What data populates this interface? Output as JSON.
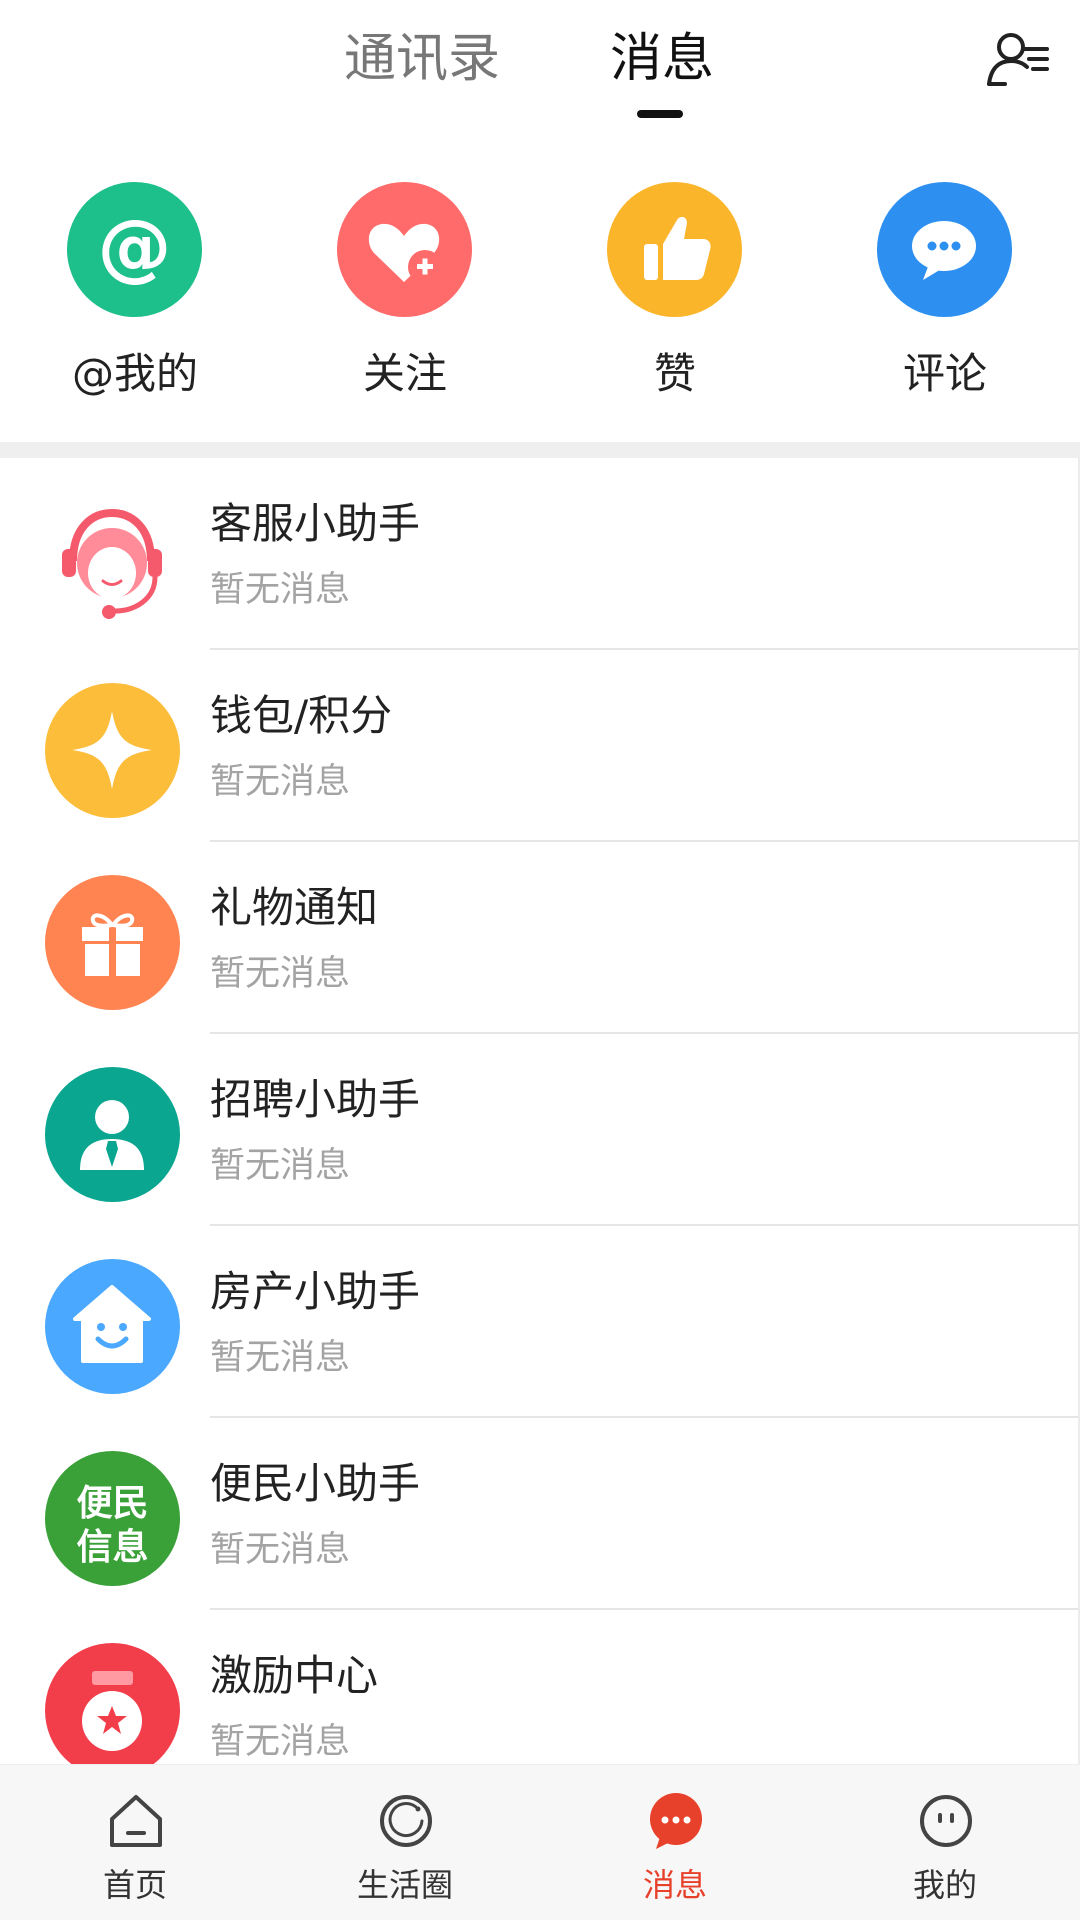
{
  "header": {
    "tabs": [
      {
        "label": "通讯录",
        "active": false
      },
      {
        "label": "消息",
        "active": true
      }
    ],
    "right_icon": "contacts-manage-icon"
  },
  "quick_actions": [
    {
      "label": "@我的",
      "icon": "at-icon",
      "color": "#1dbf8b"
    },
    {
      "label": "关注",
      "icon": "heart-plus-icon",
      "color": "#ff6b6b"
    },
    {
      "label": "赞",
      "icon": "thumbs-up-icon",
      "color": "#fbb52b"
    },
    {
      "label": "评论",
      "icon": "comment-bubble-icon",
      "color": "#2d90f0"
    }
  ],
  "messages": [
    {
      "title": "客服小助手",
      "subtitle": "暂无消息",
      "icon": "customer-service-icon",
      "color": "#ff6f7e"
    },
    {
      "title": "钱包/积分",
      "subtitle": "暂无消息",
      "icon": "diamond-star-icon",
      "color": "#fbbd3a"
    },
    {
      "title": "礼物通知",
      "subtitle": "暂无消息",
      "icon": "gift-icon",
      "color": "#ff8452"
    },
    {
      "title": "招聘小助手",
      "subtitle": "暂无消息",
      "icon": "recruiter-icon",
      "color": "#0aa690"
    },
    {
      "title": "房产小助手",
      "subtitle": "暂无消息",
      "icon": "smiling-house-icon",
      "color": "#4aa8ff"
    },
    {
      "title": "便民小助手",
      "subtitle": "暂无消息",
      "icon": "convenience-info-badge",
      "color": "#3aa038",
      "badge_text_1": "便民",
      "badge_text_2": "信息"
    },
    {
      "title": "激励中心",
      "subtitle": "暂无消息",
      "icon": "medal-icon",
      "color": "#f23d4a"
    }
  ],
  "bottom_nav": [
    {
      "label": "首页",
      "icon": "home-icon",
      "active": false
    },
    {
      "label": "生活圈",
      "icon": "life-circle-icon",
      "active": false
    },
    {
      "label": "消息",
      "icon": "message-dots-icon",
      "active": true
    },
    {
      "label": "我的",
      "icon": "profile-face-icon",
      "active": false
    }
  ],
  "colors": {
    "accent": "#e8412b"
  }
}
